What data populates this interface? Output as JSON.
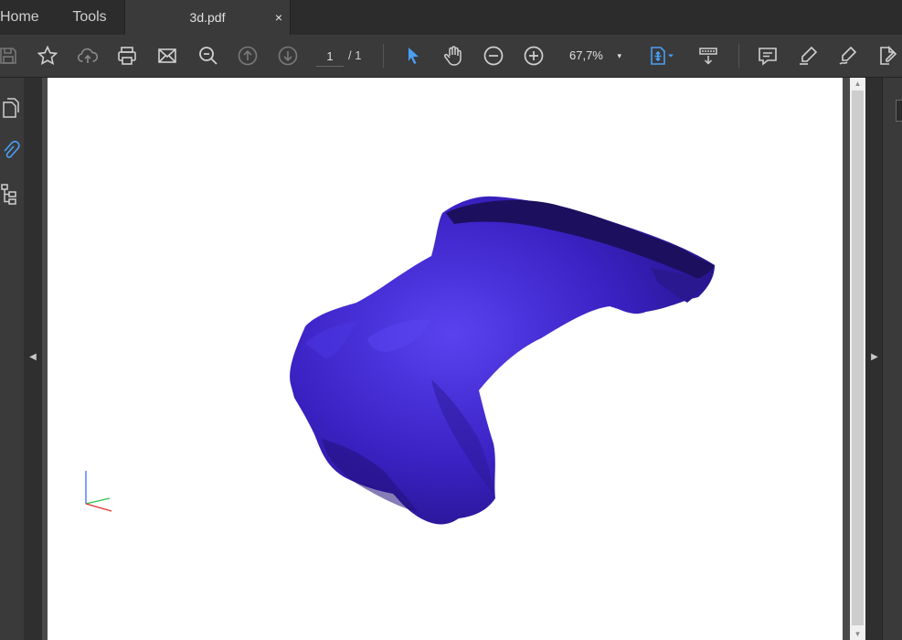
{
  "tabs": {
    "home": "Home",
    "tools": "Tools",
    "document": "3d.pdf",
    "close": "×"
  },
  "toolbar": {
    "page_current": "1",
    "page_total": "/ 1",
    "zoom": "67,7%",
    "zoom_arrow": "▾"
  },
  "nav": {
    "left_arrow": "◀",
    "right_arrow": "▶",
    "scroll_up": "▲",
    "scroll_down": "▼"
  },
  "colors": {
    "accent": "#4a9ff5",
    "model_main": "#3d25c8",
    "model_shadow": "#1c0f5e",
    "page_bg": "#ffffff"
  },
  "icons": [
    "save-icon",
    "bookmark-star-icon",
    "cloud-upload-icon",
    "print-icon",
    "email-icon",
    "search-zoom-icon",
    "page-up-icon",
    "page-down-icon",
    "select-cursor-icon",
    "hand-tool-icon",
    "zoom-out-icon",
    "zoom-in-icon",
    "fit-page-icon",
    "scroll-mode-icon",
    "comment-icon",
    "highlight-icon",
    "sign-icon",
    "fill-sign-icon"
  ]
}
